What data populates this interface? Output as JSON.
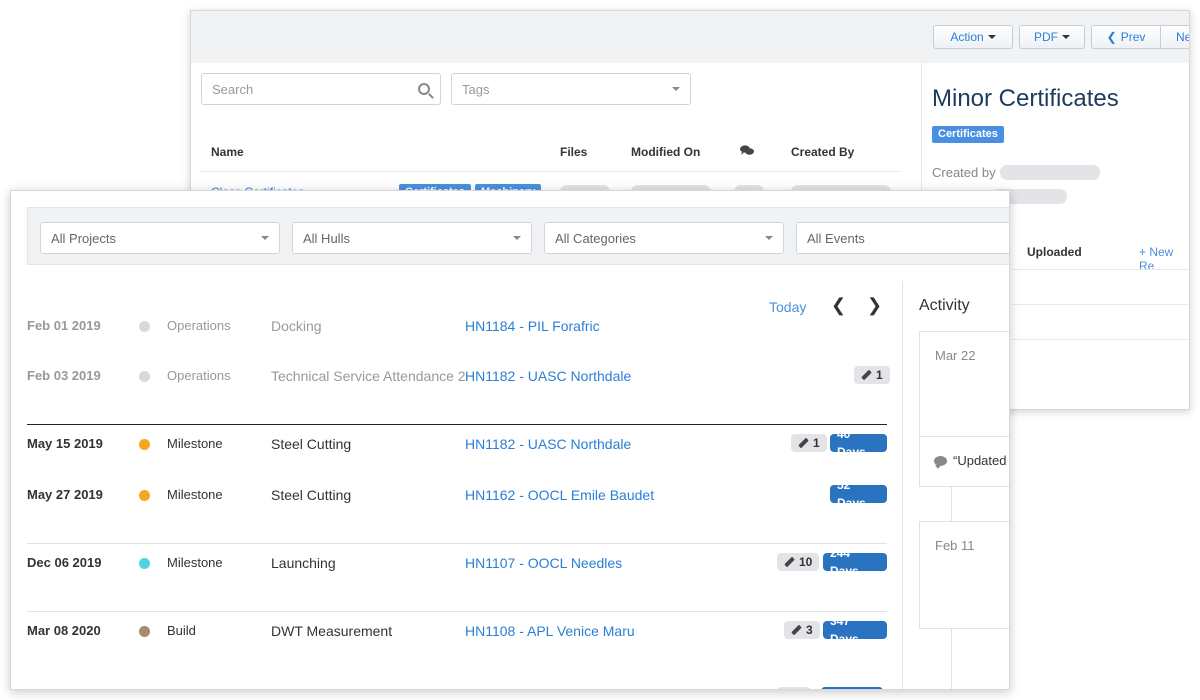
{
  "back_window": {
    "toolbar": {
      "action_label": "Action",
      "pdf_label": "PDF",
      "prev_label": "Prev",
      "next_label": "Ne"
    },
    "search_placeholder": "Search",
    "tags_placeholder": "Tags",
    "columns": [
      "Name",
      "Files",
      "Modified On",
      "Created By"
    ],
    "rows": [
      {
        "name": "Class Certificates",
        "tags": [
          "Certificates",
          "Machinery"
        ]
      }
    ],
    "detail": {
      "title": "Minor Certificates",
      "tag": "Certificates",
      "created_by_label": "Created by",
      "uploaded_label": "Uploaded",
      "new_label": "+ New Re"
    }
  },
  "front_window": {
    "filters": [
      "All Projects",
      "All Hulls",
      "All Categories",
      "All Events"
    ],
    "today_label": "Today",
    "events": [
      {
        "date": "Feb 01 2019",
        "type": "Operations",
        "name": "Docking",
        "hull": "HN1184 - PIL Forafric",
        "comments": null,
        "days": null,
        "dot_color": "#d9d9d9",
        "past": true
      },
      {
        "date": "Feb 03 2019",
        "type": "Operations",
        "name": "Technical Service Attendance 2",
        "hull": "HN1182 - UASC Northdale",
        "comments": "1",
        "days": null,
        "dot_color": "#d9d9d9",
        "past": true
      },
      {
        "date": "May 15 2019",
        "type": "Milestone",
        "name": "Steel Cutting",
        "hull": "HN1182 - UASC Northdale",
        "comments": "1",
        "days": "40 Days",
        "dot_color": "#f5a623",
        "past": false
      },
      {
        "date": "May 27 2019",
        "type": "Milestone",
        "name": "Steel Cutting",
        "hull": "HN1162 - OOCL Emile Baudet",
        "comments": null,
        "days": "52 Days",
        "dot_color": "#f5a623",
        "past": false
      },
      {
        "date": "Dec 06 2019",
        "type": "Milestone",
        "name": "Launching",
        "hull": "HN1107 - OOCL Needles",
        "comments": "10",
        "days": "244 Days",
        "dot_color": "#50d2e0",
        "past": false
      },
      {
        "date": "Mar 08 2020",
        "type": "Build",
        "name": "DWT Measurement",
        "hull": "HN1108 - APL Venice Maru",
        "comments": "3",
        "days": "347 Days",
        "dot_color": "#a58b6f",
        "past": false
      }
    ],
    "activity": {
      "title": "Activity",
      "cards": [
        {
          "date": "Mar 22",
          "quote": "“Updated"
        },
        {
          "date": "Feb 11"
        }
      ]
    }
  }
}
